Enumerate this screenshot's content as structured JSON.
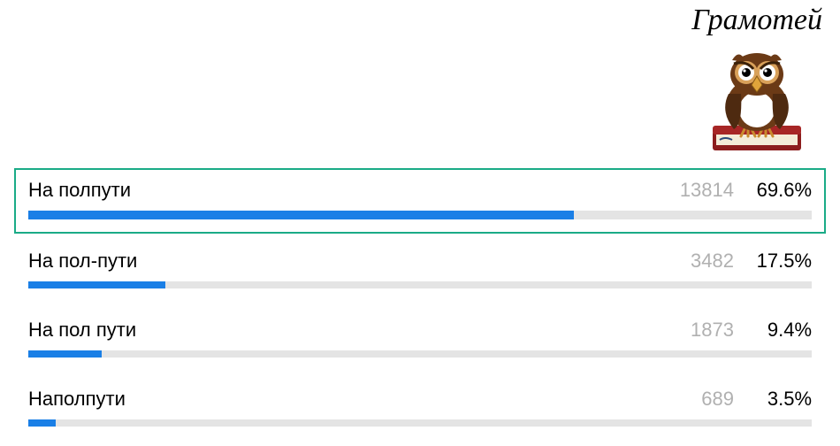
{
  "brand": {
    "name": "Грамотей"
  },
  "poll": {
    "options": [
      {
        "label": "На полпути",
        "count": 13814,
        "percent": 69.6,
        "highlight": true
      },
      {
        "label": "На пол-пути",
        "count": 3482,
        "percent": 17.5,
        "highlight": false
      },
      {
        "label": "На пол пути",
        "count": 1873,
        "percent": 9.4,
        "highlight": false
      },
      {
        "label": "Наполпути",
        "count": 689,
        "percent": 3.5,
        "highlight": false
      }
    ]
  },
  "colors": {
    "accent": "#1a7fe6",
    "highlight_border": "#1aab87",
    "muted": "#b0b0b0",
    "track": "#e4e4e4"
  },
  "chart_data": {
    "type": "bar",
    "title": "",
    "categories": [
      "На полпути",
      "На пол-пути",
      "На пол пути",
      "Наполпути"
    ],
    "series": [
      {
        "name": "count",
        "values": [
          13814,
          3482,
          1873,
          689
        ]
      },
      {
        "name": "percent",
        "values": [
          69.6,
          17.5,
          9.4,
          3.5
        ]
      }
    ],
    "xlabel": "",
    "ylabel": "",
    "ylim": [
      0,
      100
    ]
  }
}
